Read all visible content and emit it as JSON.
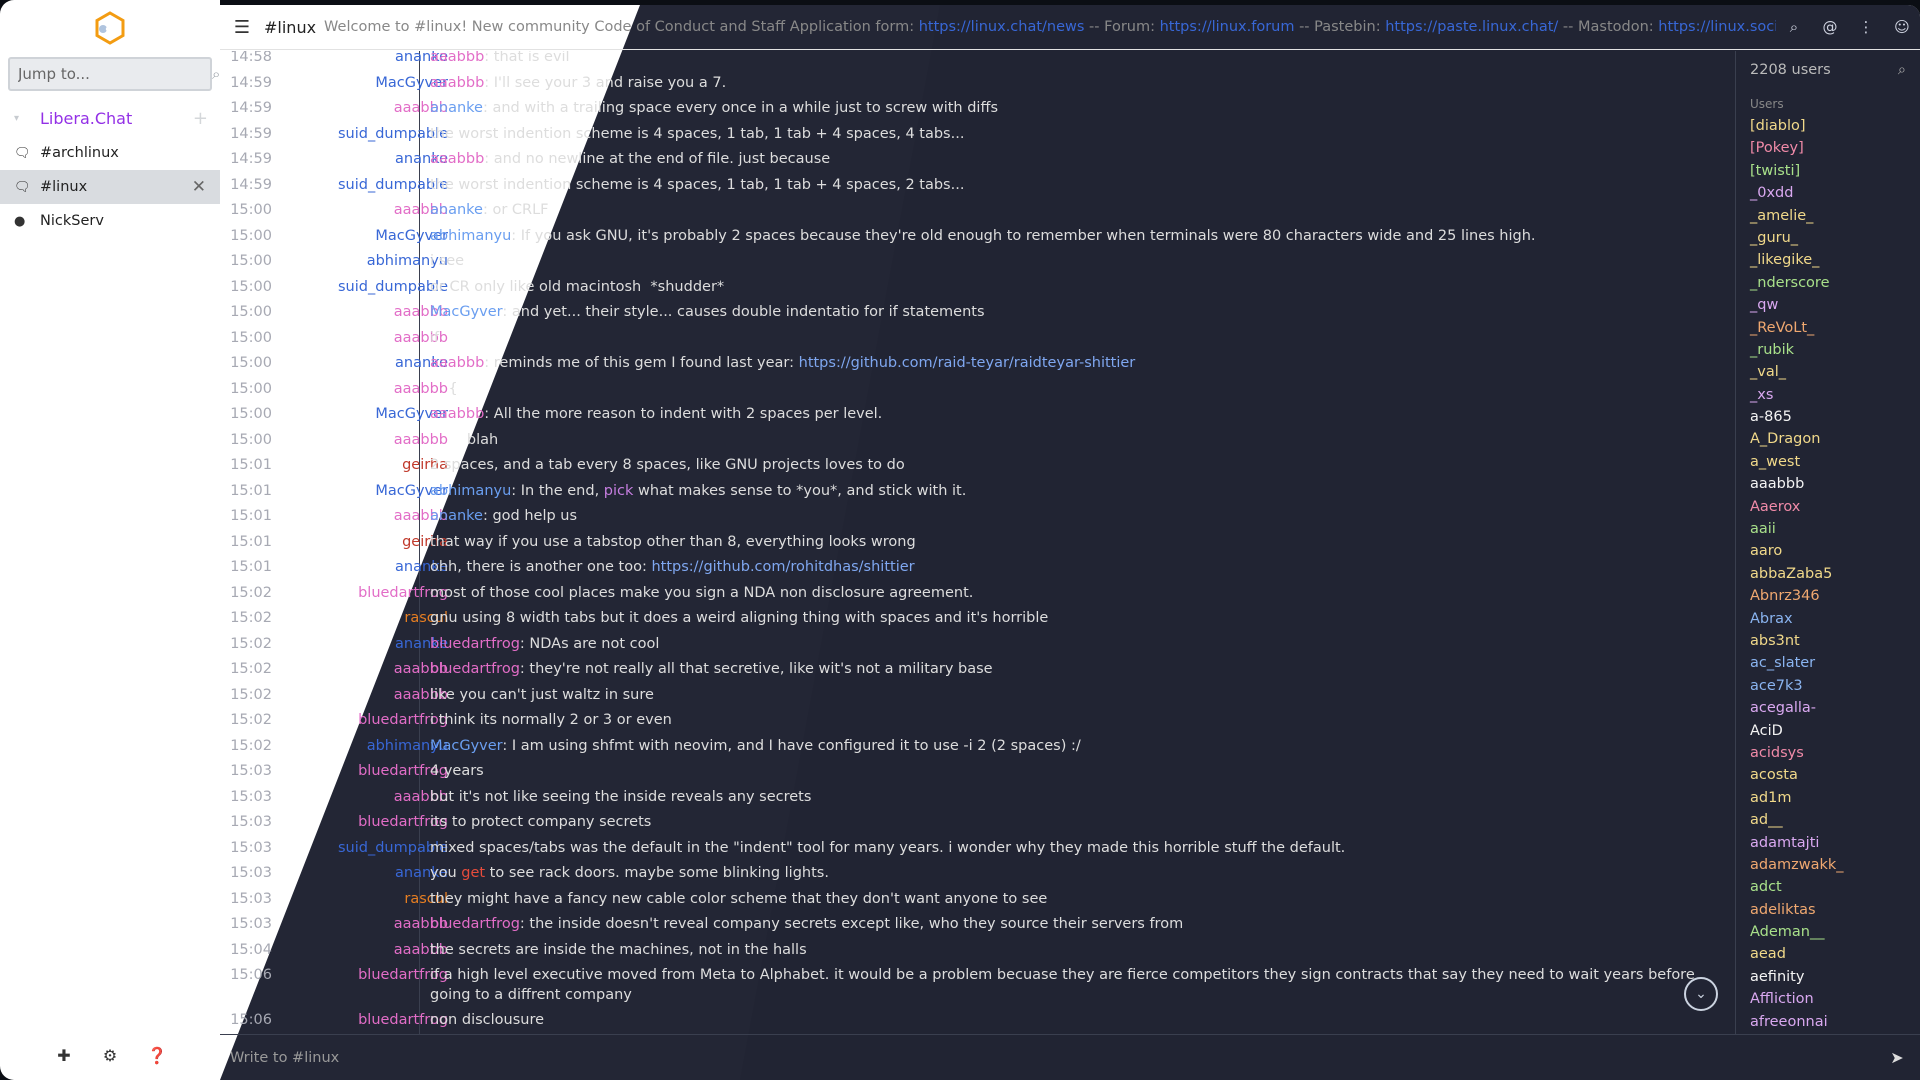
{
  "colors": {
    "dark_bg": "#232635",
    "light_bg": "#ffffff",
    "accent_purple": "#9330e6",
    "link": "#3867d6"
  },
  "sidebar": {
    "jump_placeholder": "Jump to...",
    "network": "Libera.Chat",
    "channels": [
      {
        "label": "#archlinux",
        "icon": "chat-icon",
        "active": false
      },
      {
        "label": "#linux",
        "icon": "chat-icon",
        "active": true
      },
      {
        "label": "NickServ",
        "icon": "query-icon",
        "active": false
      }
    ],
    "footer_icons": [
      "plus-icon",
      "gear-icon",
      "help-icon"
    ]
  },
  "header": {
    "channel": "#linux",
    "topic_prefix": "Welcome to #linux! New community Code of Conduct and Staff Application form: ",
    "topic_link1": "https://linux.chat/news",
    "topic_mid1": " -- Forum: ",
    "topic_link2": "https://linux.forum",
    "topic_mid2": " -- Pastebin: ",
    "topic_link3": "https://paste.linux.chat/",
    "topic_mid3": " -- Mastodon: ",
    "topic_link4": "https://linux.social/invite"
  },
  "messages": [
    {
      "time": "14:58",
      "nick": "ananke",
      "nick_color": "#3867d6",
      "parts": [
        {
          "t": "aaabbb",
          "c": "#e26dc7"
        },
        {
          "t": ": that is evil"
        }
      ]
    },
    {
      "time": "14:59",
      "nick": "MacGyver",
      "nick_color": "#3867d6",
      "parts": [
        {
          "t": "aaabbb",
          "c": "#e26dc7"
        },
        {
          "t": ": I'll see your 3 and raise you a 7."
        }
      ]
    },
    {
      "time": "14:59",
      "nick": "aaabbb",
      "nick_color": "#e26dc7",
      "parts": [
        {
          "t": "ananke",
          "c": "#6a9ef0"
        },
        {
          "t": ": and with a trailing space every once in a while just to screw with diffs"
        }
      ]
    },
    {
      "time": "14:59",
      "nick": "suid_dumpable",
      "nick_color": "#3867d6",
      "parts": [
        {
          "t": "the worst indention scheme is 4 spaces, 1 tab, 1 tab + 4 spaces, 4 tabs..."
        }
      ]
    },
    {
      "time": "14:59",
      "nick": "ananke",
      "nick_color": "#3867d6",
      "parts": [
        {
          "t": "aaabbb",
          "c": "#e26dc7"
        },
        {
          "t": ": and no newline at the end of file. just because"
        }
      ]
    },
    {
      "time": "14:59",
      "nick": "suid_dumpable",
      "nick_color": "#3867d6",
      "parts": [
        {
          "t": "the worst indention scheme is 4 spaces, 1 tab, 1 tab + 4 spaces, 2 tabs..."
        }
      ]
    },
    {
      "time": "15:00",
      "nick": "aaabbb",
      "nick_color": "#e26dc7",
      "parts": [
        {
          "t": "ananke",
          "c": "#6a9ef0"
        },
        {
          "t": ": or CRLF"
        }
      ]
    },
    {
      "time": "15:00",
      "nick": "MacGyver",
      "nick_color": "#3867d6",
      "parts": [
        {
          "t": "abhimanyu",
          "c": "#6a9ef0"
        },
        {
          "t": ": If you ask GNU, it's probably 2 spaces because they're old enough to remember when terminals were 80 characters wide and 25 lines high."
        }
      ]
    },
    {
      "time": "15:00",
      "nick": "abhimanyu",
      "nick_color": "#3867d6",
      "parts": [
        {
          "t": "i see"
        }
      ]
    },
    {
      "time": "15:00",
      "nick": "suid_dumpable",
      "nick_color": "#3867d6",
      "parts": [
        {
          "t": "or CR only like old macintosh  *shudder*"
        }
      ]
    },
    {
      "time": "15:00",
      "nick": "aaabbb",
      "nick_color": "#e26dc7",
      "parts": [
        {
          "t": "MacGyver",
          "c": "#6a9ef0"
        },
        {
          "t": ": and yet... their style... causes double indentatio for if statements"
        }
      ]
    },
    {
      "time": "15:00",
      "nick": "aaabbb",
      "nick_color": "#e26dc7",
      "parts": [
        {
          "t": "if"
        }
      ]
    },
    {
      "time": "15:00",
      "nick": "ananke",
      "nick_color": "#3867d6",
      "parts": [
        {
          "t": "aaabbb",
          "c": "#e26dc7"
        },
        {
          "t": ": reminds me of this gem I found last year: "
        },
        {
          "t": "https://github.com/raid-teyar/raidteyar-shittier",
          "link": true
        }
      ]
    },
    {
      "time": "15:00",
      "nick": "aaabbb",
      "nick_color": "#e26dc7",
      "parts": [
        {
          "t": "    {"
        }
      ]
    },
    {
      "time": "15:00",
      "nick": "MacGyver",
      "nick_color": "#3867d6",
      "parts": [
        {
          "t": "aaabbb",
          "c": "#e26dc7"
        },
        {
          "t": ": All the more reason to indent with 2 spaces per level."
        }
      ]
    },
    {
      "time": "15:00",
      "nick": "aaabbb",
      "nick_color": "#e26dc7",
      "parts": [
        {
          "t": "        blah"
        }
      ]
    },
    {
      "time": "15:01",
      "nick": "geirha",
      "nick_color": "#c0392b",
      "parts": [
        {
          "t": "2 spaces, and a tab every 8 spaces, like GNU projects loves to do"
        }
      ]
    },
    {
      "time": "15:01",
      "nick": "MacGyver",
      "nick_color": "#3867d6",
      "parts": [
        {
          "t": "abhimanyu",
          "c": "#6a9ef0"
        },
        {
          "t": ": In the end, "
        },
        {
          "t": "pick",
          "c": "#c67ee0"
        },
        {
          "t": " what makes sense to *you*, and stick with it."
        }
      ]
    },
    {
      "time": "15:01",
      "nick": "aaabbb",
      "nick_color": "#e26dc7",
      "parts": [
        {
          "t": "ananke",
          "c": "#6a9ef0"
        },
        {
          "t": ": god help us"
        }
      ]
    },
    {
      "time": "15:01",
      "nick": "geirha",
      "nick_color": "#c0392b",
      "parts": [
        {
          "t": "that way if you use a tabstop other than 8, everything looks wrong"
        }
      ]
    },
    {
      "time": "15:01",
      "nick": "ananke",
      "nick_color": "#3867d6",
      "parts": [
        {
          "t": "ohh, there is another one too: "
        },
        {
          "t": "https://github.com/rohitdhas/shittier",
          "link": true
        }
      ]
    },
    {
      "time": "15:02",
      "nick": "bluedartfrog",
      "nick_color": "#e26dc7",
      "parts": [
        {
          "t": "most of those cool places make you sign a NDA non disclosure agreement."
        }
      ]
    },
    {
      "time": "15:02",
      "nick": "rascul",
      "nick_color": "#e67e22",
      "parts": [
        {
          "t": "gnu using 8 width tabs but it does a weird aligning thing with spaces and it's horrible"
        }
      ]
    },
    {
      "time": "15:02",
      "nick": "ananke",
      "nick_color": "#3867d6",
      "parts": [
        {
          "t": "bluedartfrog",
          "c": "#e26dc7"
        },
        {
          "t": ": NDAs are not cool"
        }
      ]
    },
    {
      "time": "15:02",
      "nick": "aaabbb",
      "nick_color": "#e26dc7",
      "parts": [
        {
          "t": "bluedartfrog",
          "c": "#e26dc7"
        },
        {
          "t": ": they're not really all that secretive, like wit's not a military base"
        }
      ]
    },
    {
      "time": "15:02",
      "nick": "aaabbb",
      "nick_color": "#e26dc7",
      "parts": [
        {
          "t": "like you can't just waltz in sure"
        }
      ]
    },
    {
      "time": "15:02",
      "nick": "bluedartfrog",
      "nick_color": "#e26dc7",
      "parts": [
        {
          "t": "i think its normally 2 or 3 or even"
        }
      ]
    },
    {
      "time": "15:02",
      "nick": "abhimanyu",
      "nick_color": "#3867d6",
      "parts": [
        {
          "t": "MacGyver",
          "c": "#6a9ef0"
        },
        {
          "t": ": I am using shfmt with neovim, and I have configured it to use -i 2 (2 spaces) :/"
        }
      ]
    },
    {
      "time": "15:03",
      "nick": "bluedartfrog",
      "nick_color": "#e26dc7",
      "parts": [
        {
          "t": "4 years"
        }
      ]
    },
    {
      "time": "15:03",
      "nick": "aaabbb",
      "nick_color": "#e26dc7",
      "parts": [
        {
          "t": "but it's not like seeing the inside reveals any secrets"
        }
      ]
    },
    {
      "time": "15:03",
      "nick": "bluedartfrog",
      "nick_color": "#e26dc7",
      "parts": [
        {
          "t": "its to protect company secrets"
        }
      ]
    },
    {
      "time": "15:03",
      "nick": "suid_dumpable",
      "nick_color": "#3867d6",
      "parts": [
        {
          "t": "mixed spaces/tabs was the default in the \"indent\" tool for many years. i wonder why they made this horrible stuff the default."
        }
      ]
    },
    {
      "time": "15:03",
      "nick": "ananke",
      "nick_color": "#3867d6",
      "parts": [
        {
          "t": "you "
        },
        {
          "t": "get",
          "c": "#e74c3c"
        },
        {
          "t": " to see rack doors. maybe some blinking lights."
        }
      ]
    },
    {
      "time": "15:03",
      "nick": "rascul",
      "nick_color": "#e67e22",
      "parts": [
        {
          "t": "they might have a fancy new cable color scheme that they don't want anyone to see"
        }
      ]
    },
    {
      "time": "15:03",
      "nick": "aaabbb",
      "nick_color": "#e26dc7",
      "parts": [
        {
          "t": "bluedartfrog",
          "c": "#e26dc7"
        },
        {
          "t": ": the inside doesn't reveal company secrets except like, who they source their servers from"
        }
      ]
    },
    {
      "time": "15:04",
      "nick": "aaabbb",
      "nick_color": "#e26dc7",
      "parts": [
        {
          "t": "the secrets are inside the machines, not in the halls"
        }
      ]
    },
    {
      "time": "15:06",
      "nick": "bluedartfrog",
      "nick_color": "#e26dc7",
      "parts": [
        {
          "t": "if a high level executive moved from Meta to Alphabet. it would be a problem becuase they are fierce competitors they sign contracts that say they need to wait years before going to a diffrent company"
        }
      ]
    },
    {
      "time": "15:06",
      "nick": "bluedartfrog",
      "nick_color": "#e26dc7",
      "parts": [
        {
          "t": "non disclousure"
        }
      ]
    }
  ],
  "userlist": {
    "count": "2208 users",
    "section": "Users",
    "users": [
      {
        "n": "[diablo]",
        "c": "#f1d98a"
      },
      {
        "n": "[Pokey]",
        "c": "#f08aa8"
      },
      {
        "n": "[twisti]",
        "c": "#a8e08a"
      },
      {
        "n": "_0xdd",
        "c": "#d9a8f0"
      },
      {
        "n": "_amelie_",
        "c": "#f1d98a"
      },
      {
        "n": "_guru_",
        "c": "#f1d98a"
      },
      {
        "n": "_likegike_",
        "c": "#f1d98a"
      },
      {
        "n": "_nderscore",
        "c": "#a8e08a"
      },
      {
        "n": "_qw",
        "c": "#d9a8f0"
      },
      {
        "n": "_ReVoLt_",
        "c": "#f0a870"
      },
      {
        "n": "_rubik",
        "c": "#a8e08a"
      },
      {
        "n": "_val_",
        "c": "#f1d98a"
      },
      {
        "n": "_xs",
        "c": "#d9a8f0"
      },
      {
        "n": "a-865",
        "c": "#f4f4f4"
      },
      {
        "n": "A_Dragon",
        "c": "#f1d98a"
      },
      {
        "n": "a_west",
        "c": "#f1d98a"
      },
      {
        "n": "aaabbb",
        "c": "#f4f4f4"
      },
      {
        "n": "Aaerox",
        "c": "#f08aa8"
      },
      {
        "n": "aaii",
        "c": "#a8e08a"
      },
      {
        "n": "aaro",
        "c": "#f1d98a"
      },
      {
        "n": "abbaZaba5",
        "c": "#f1d98a"
      },
      {
        "n": "Abnrz346",
        "c": "#f0a870"
      },
      {
        "n": "Abrax",
        "c": "#8ab4f0"
      },
      {
        "n": "abs3nt",
        "c": "#f1d98a"
      },
      {
        "n": "ac_slater",
        "c": "#8ab4f0"
      },
      {
        "n": "ace7k3",
        "c": "#8ab4f0"
      },
      {
        "n": "acegalla-",
        "c": "#d9a8f0"
      },
      {
        "n": "AciD",
        "c": "#f4f4f4"
      },
      {
        "n": "acidsys",
        "c": "#f08aa8"
      },
      {
        "n": "acosta",
        "c": "#f1d98a"
      },
      {
        "n": "ad1m",
        "c": "#f1d98a"
      },
      {
        "n": "ad__",
        "c": "#f1d98a"
      },
      {
        "n": "adamtajti",
        "c": "#d9a8f0"
      },
      {
        "n": "adamzwakk_",
        "c": "#f0a870"
      },
      {
        "n": "adct",
        "c": "#a8e08a"
      },
      {
        "n": "adeliktas",
        "c": "#f0a870"
      },
      {
        "n": "Ademan__",
        "c": "#a8e08a"
      },
      {
        "n": "aead",
        "c": "#f1d98a"
      },
      {
        "n": "aefinity",
        "c": "#f4f4f4"
      },
      {
        "n": "Affliction",
        "c": "#d9a8f0"
      },
      {
        "n": "afreeonnai",
        "c": "#d9a8f0"
      }
    ]
  },
  "input": {
    "placeholder": "Write to #linux"
  }
}
